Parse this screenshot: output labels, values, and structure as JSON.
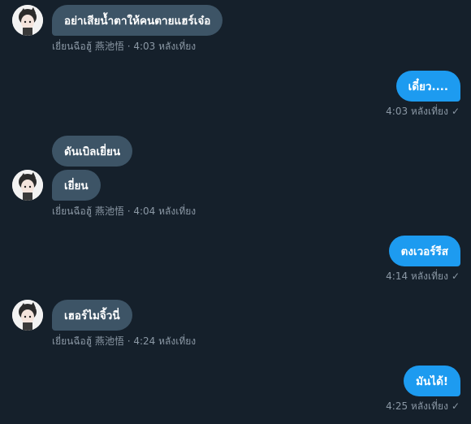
{
  "contact": {
    "avatar_icon": "avatar-icon",
    "name": "เยี่ยนฉือฮู้ 燕池悟"
  },
  "messages": [
    {
      "dir": "in",
      "text": "อย่าเสียน้ำตาให้คนตายแฮร์เจ๋อ"
    },
    {
      "dir": "out",
      "text": "เดี๋ยว...."
    },
    {
      "dir": "in",
      "text": "ดันเบิลเยี่ยน"
    },
    {
      "dir": "in",
      "text": "เยี่ยน"
    },
    {
      "dir": "out",
      "text": "ตงเวอร์รีส"
    },
    {
      "dir": "in",
      "text": "เฮอร์ไมจิ้วนี่"
    },
    {
      "dir": "out",
      "text": "มันได้!"
    }
  ],
  "meta": [
    {
      "text": "เยี่ยนฉือฮู้ 燕池悟 · 4:03 หลังเที่ยง"
    },
    {
      "text": "4:03 หลังเที่ยง"
    },
    {
      "text": "เยี่ยนฉือฮู้ 燕池悟 · 4:04 หลังเที่ยง"
    },
    {
      "text": "4:14 หลังเที่ยง"
    },
    {
      "text": "เยี่ยนฉือฮู้ 燕池悟 · 4:24 หลังเที่ยง"
    },
    {
      "text": "4:25 หลังเที่ยง"
    }
  ],
  "read_check_icon": "checkmark-icon",
  "check_glyph": "✓",
  "colors": {
    "background": "#15202b",
    "incoming_bubble": "#3d5466",
    "outgoing_bubble": "#1d9bf0",
    "meta_text": "#8b98a5"
  }
}
